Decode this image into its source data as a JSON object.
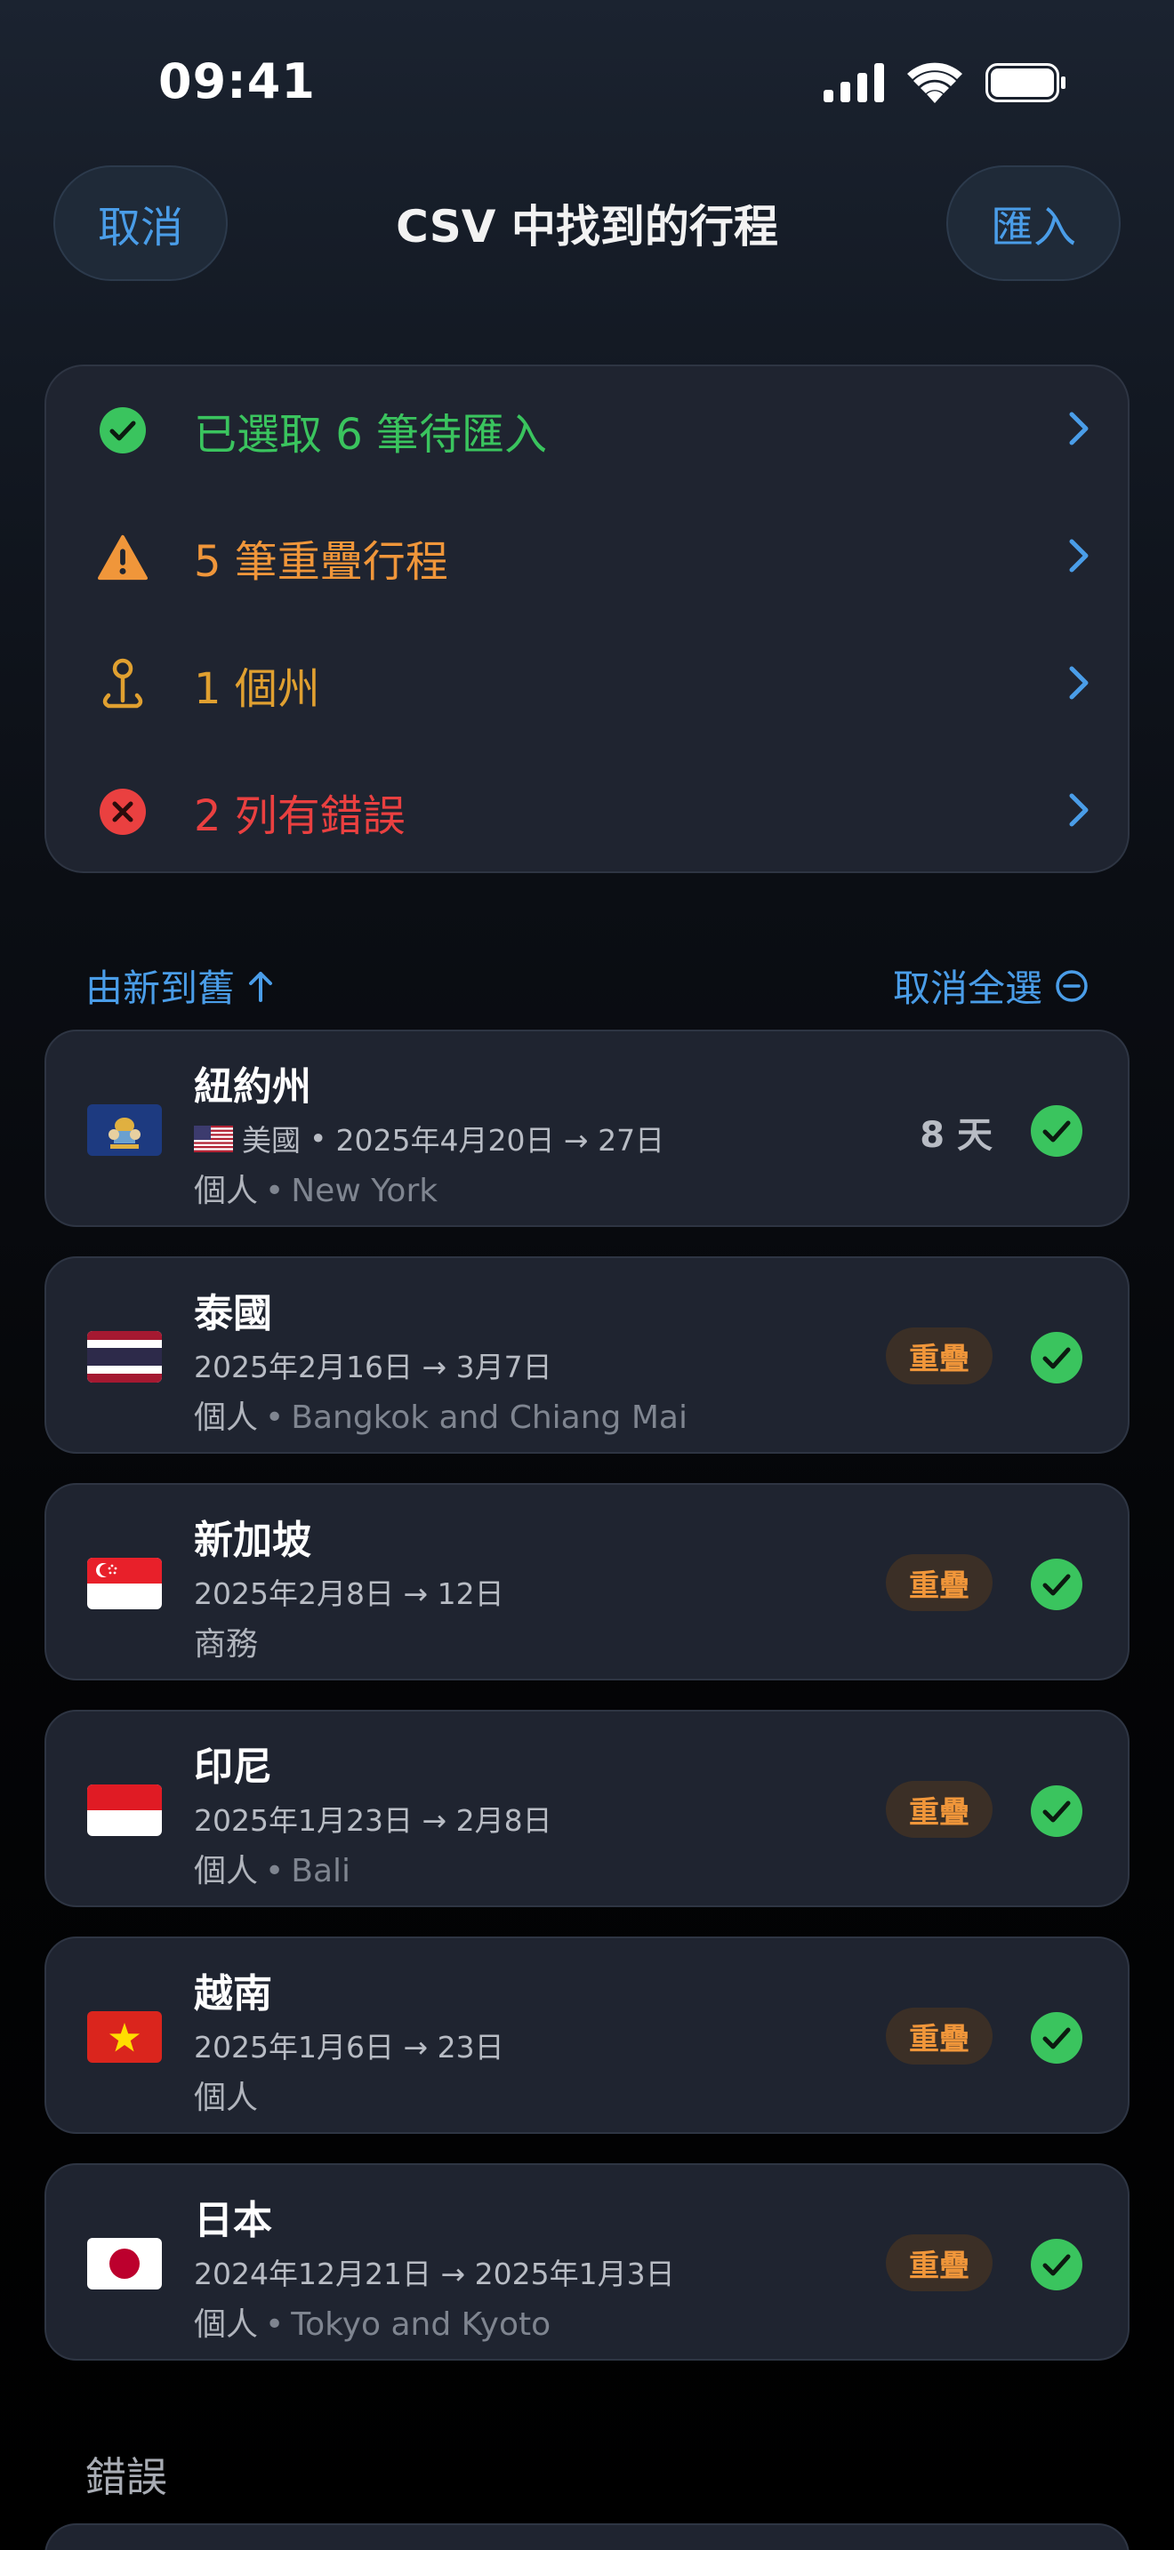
{
  "status": {
    "time": "09:41"
  },
  "nav": {
    "cancel": "取消",
    "title": "CSV 中找到的行程",
    "import": "匯入"
  },
  "summary": [
    {
      "text": "已選取 6 筆待匯入",
      "color": "#3ac45e",
      "icon": "check-circle-icon"
    },
    {
      "text": "5 筆重疊行程",
      "color": "#f0963a",
      "icon": "warning-icon"
    },
    {
      "text": "1 個州",
      "color": "#e0a030",
      "icon": "map-pin-icon"
    },
    {
      "text": "2 列有錯誤",
      "color": "#ea4040",
      "icon": "error-circle-icon"
    }
  ],
  "list": {
    "sort_label": "由新到舊",
    "deselect_label": "取消全選"
  },
  "trips": [
    {
      "title": "紐約州",
      "country": "美國",
      "dates": "2025年4月20日 → 27日",
      "type": "個人",
      "place": "New York",
      "days": "8 天",
      "flag": "ny"
    },
    {
      "title": "泰國",
      "dates": "2025年2月16日 → 3月7日",
      "type": "個人",
      "place": "Bangkok and Chiang Mai",
      "badge": "重疊",
      "flag": "th"
    },
    {
      "title": "新加坡",
      "dates": "2025年2月8日 → 12日",
      "type": "商務",
      "badge": "重疊",
      "flag": "sg"
    },
    {
      "title": "印尼",
      "dates": "2025年1月23日 → 2月8日",
      "type": "個人",
      "place": "Bali",
      "badge": "重疊",
      "flag": "id"
    },
    {
      "title": "越南",
      "dates": "2025年1月6日 → 23日",
      "type": "個人",
      "badge": "重疊",
      "flag": "vn"
    },
    {
      "title": "日本",
      "dates": "2024年12月21日 → 2025年1月3日",
      "type": "個人",
      "place": "Tokyo and Kyoto",
      "badge": "重疊",
      "flag": "jp"
    }
  ],
  "errors_section": {
    "title": "錯誤"
  },
  "colors": {
    "accent": "#4a9de8",
    "success": "#3ac45e",
    "warning": "#f0963a",
    "error": "#ea4040"
  }
}
